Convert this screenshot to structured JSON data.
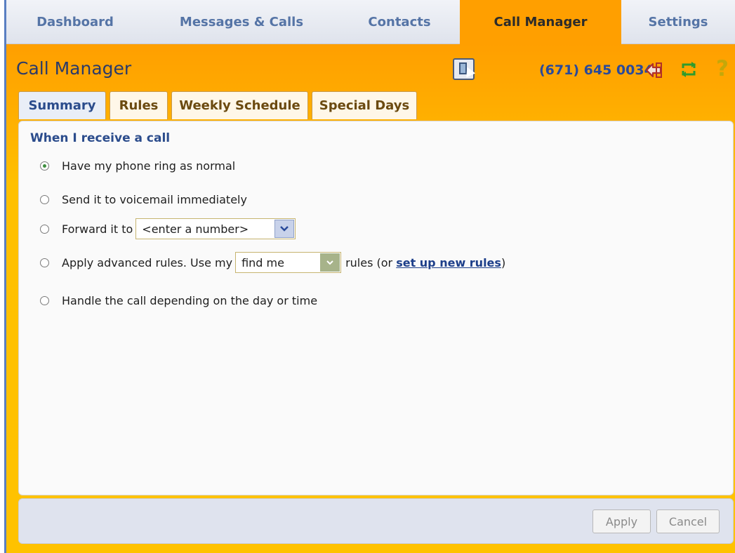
{
  "nav": {
    "tabs": [
      {
        "label": "Dashboard"
      },
      {
        "label": "Messages & Calls"
      },
      {
        "label": "Contacts"
      },
      {
        "label": "Call Manager"
      },
      {
        "label": "Settings"
      }
    ],
    "active": "Call Manager"
  },
  "header": {
    "title": "Call Manager",
    "phone_number": "(671) 645 0034",
    "icons": [
      "phone-book-icon",
      "logout-icon",
      "refresh-icon",
      "help-icon"
    ]
  },
  "subtabs": [
    {
      "label": "Summary"
    },
    {
      "label": "Rules"
    },
    {
      "label": "Weekly Schedule"
    },
    {
      "label": "Special Days"
    }
  ],
  "summary": {
    "heading": "When I receive a call",
    "options": {
      "ring_normal": "Have my phone ring as normal",
      "voicemail": "Send it to voicemail immediately",
      "forward_prefix": "Forward it to",
      "forward_value": "<enter a number>",
      "advanced_prefix": "Apply advanced rules. Use my",
      "advanced_value": "find me",
      "advanced_middle": "rules (or ",
      "advanced_link": "set up new rules",
      "advanced_suffix": ")",
      "day_time": "Handle the call depending on the day or time"
    },
    "selected": "ring_normal"
  },
  "footer": {
    "apply": "Apply",
    "cancel": "Cancel"
  },
  "colors": {
    "accent_orange": "#ff9f00",
    "nav_text": "#5574a6",
    "heading_blue": "#2b4c8c"
  }
}
